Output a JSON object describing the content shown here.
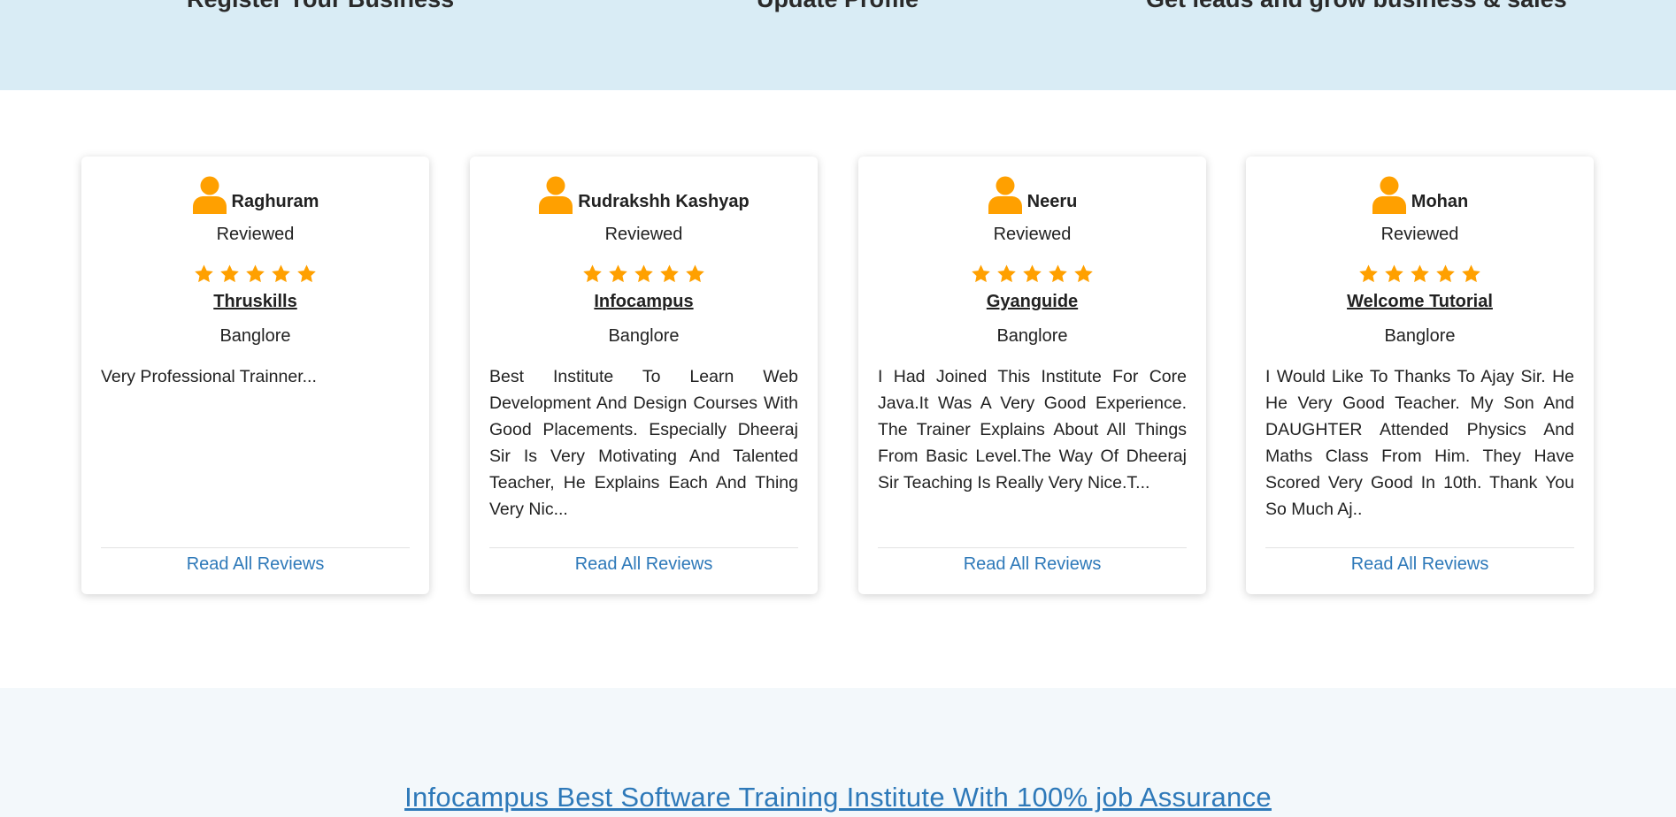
{
  "top_steps": [
    {
      "label": "Register Your Business"
    },
    {
      "label": "Update Profile"
    },
    {
      "label": "Get leads and grow business & sales"
    }
  ],
  "colors": {
    "accent_orange": "#ffa000",
    "link_blue": "#2e79b9",
    "top_band": "#d9ecf5",
    "bottom_band": "#f3f8fb"
  },
  "reviews": [
    {
      "name": "Raghuram",
      "status": "Reviewed",
      "rating": 5,
      "institute": "Thruskills",
      "city": "Banglore",
      "text": "Very Professional Trainner...",
      "link": "Read All Reviews"
    },
    {
      "name": "Rudrakshh Kashyap",
      "status": "Reviewed",
      "rating": 5,
      "institute": "Infocampus",
      "city": "Banglore",
      "text": "Best Institute To Learn Web Development And Design Courses With Good Placements. Especially Dheeraj Sir Is Very Motivating And Talented Teacher, He Explains Each And Thing Very Nic...",
      "link": "Read All Reviews"
    },
    {
      "name": "Neeru",
      "status": "Reviewed",
      "rating": 5,
      "institute": "Gyanguide",
      "city": "Banglore",
      "text": "I Had Joined This Institute For Core Java.It Was A Very Good Experience. The Trainer Explains About All Things From Basic Level.The Way Of Dheeraj Sir Teaching Is Really Very Nice.T...",
      "link": "Read All Reviews"
    },
    {
      "name": "Mohan",
      "status": "Reviewed",
      "rating": 5,
      "institute": "Welcome Tutorial",
      "city": "Banglore",
      "text": "I Would Like To Thanks To Ajay Sir. He He Very Good Teacher. My Son And DAUGHTER Attended Physics And Maths Class From Him. They Have Scored Very Good In 10th. Thank You So Much Aj..",
      "link": "Read All Reviews"
    }
  ],
  "bottom_heading": "Infocampus Best Software Training Institute With 100% job Assurance"
}
